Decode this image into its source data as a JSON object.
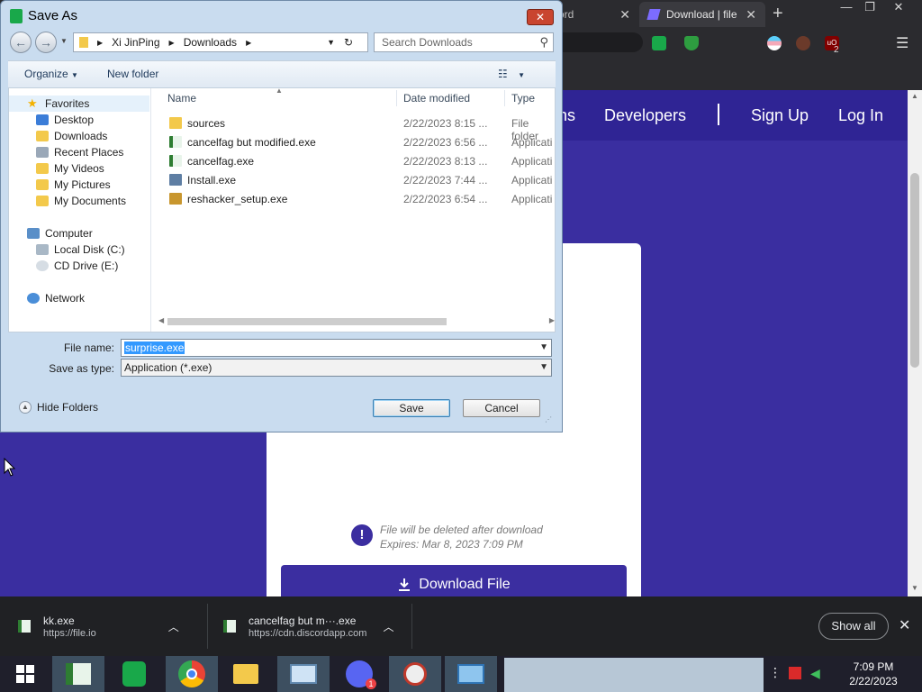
{
  "browser": {
    "tabs": [
      {
        "label": "ord",
        "active": false
      },
      {
        "label": "Download | file",
        "active": true
      }
    ],
    "new_tab": "+",
    "window_controls": [
      "—",
      "❐",
      "✕"
    ],
    "extension_badge": "2"
  },
  "site": {
    "nav": [
      "ns",
      "Developers",
      "Sign Up",
      "Log In"
    ],
    "warning_line1": "File will be deleted after download",
    "warning_line2": "Expires: Mar 8, 2023 7:09 PM",
    "download_button": "Download File"
  },
  "dialog": {
    "title": "Save As",
    "breadcrumb": [
      "Xi JinPing",
      "Downloads"
    ],
    "search_placeholder": "Search Downloads",
    "toolbar": {
      "organize": "Organize",
      "new_folder": "New folder"
    },
    "nav": {
      "favorites": "Favorites",
      "favorite_items": [
        "Desktop",
        "Downloads",
        "Recent Places",
        "My Videos",
        "My Pictures",
        "My Documents"
      ],
      "computer": "Computer",
      "computer_items": [
        "Local Disk (C:)",
        "CD Drive (E:)"
      ],
      "network": "Network"
    },
    "columns": [
      "Name",
      "Date modified",
      "Type"
    ],
    "files": [
      {
        "name": "sources",
        "date": "2/22/2023 8:15 ...",
        "type": "File folder",
        "icon": "folder-icon"
      },
      {
        "name": "cancelfag but modified.exe",
        "date": "2/22/2023 6:56 ...",
        "type": "Applicati",
        "icon": "exe-icon"
      },
      {
        "name": "cancelfag.exe",
        "date": "2/22/2023 8:13 ...",
        "type": "Applicati",
        "icon": "exe-icon"
      },
      {
        "name": "Install.exe",
        "date": "2/22/2023 7:44 ...",
        "type": "Applicati",
        "icon": "installer-icon"
      },
      {
        "name": "reshacker_setup.exe",
        "date": "2/22/2023 6:54 ...",
        "type": "Applicati",
        "icon": "reshacker-icon"
      }
    ],
    "file_name_label": "File name:",
    "file_name_value": "surprise.exe",
    "save_type_label": "Save as type:",
    "save_type_value": "Application (*.exe)",
    "hide_folders": "Hide Folders",
    "save": "Save",
    "cancel": "Cancel"
  },
  "downloads": [
    {
      "name": "kk.exe",
      "source": "https://file.io"
    },
    {
      "name": "cancelfag but m···.exe",
      "source": "https://cdn.discordapp.com"
    }
  ],
  "downloads_show_all": "Show all",
  "taskbar": {
    "time": "7:09 PM",
    "date": "2/22/2023",
    "discord_badge": "1"
  },
  "colors": {
    "site_purple": "#3a2ea0",
    "dialog_frame": "#c9dcef",
    "selection": "#3399ff"
  }
}
